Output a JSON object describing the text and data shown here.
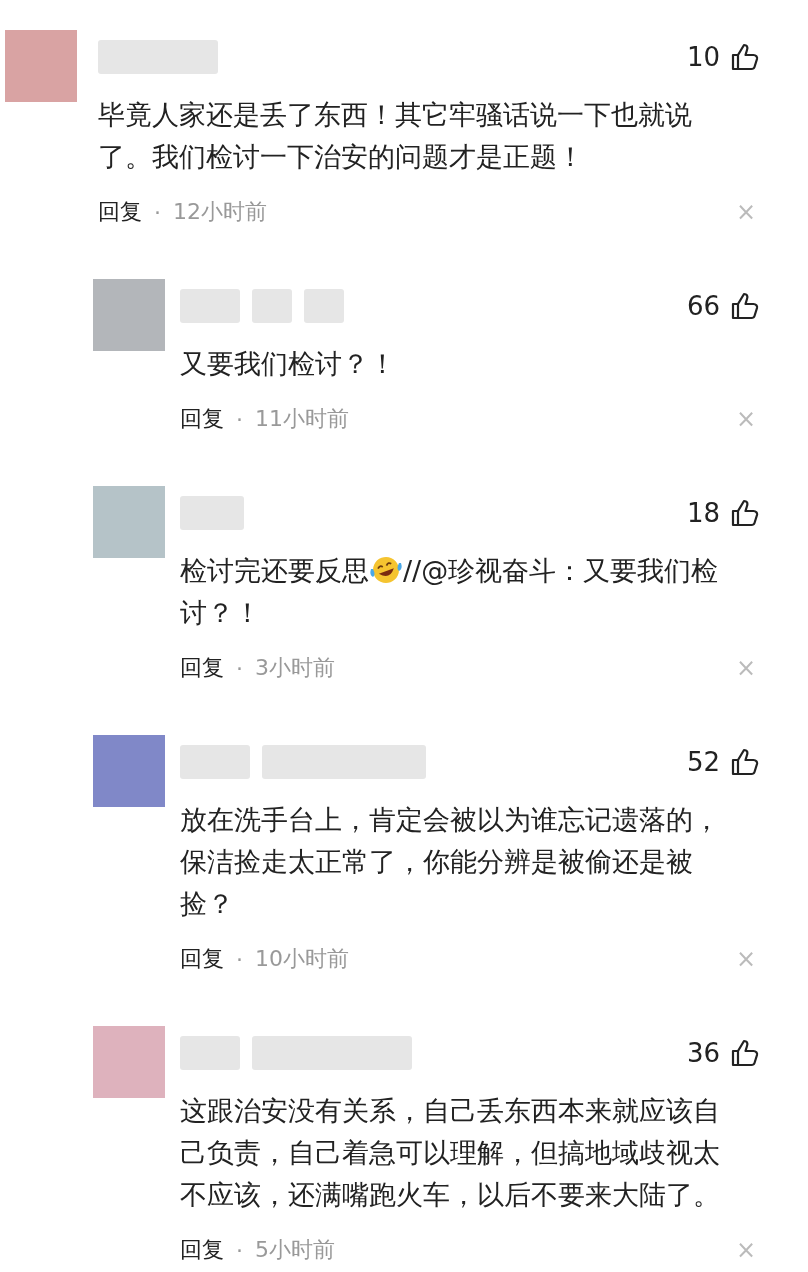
{
  "comment": {
    "color": "#d9a3a3",
    "likes": "10",
    "parts": [
      {
        "kind": "text",
        "text": "毕竟人家还是丢了东西！其它牢骚话说一下也就说了。我们检讨一下治安的问题才是正题！"
      }
    ],
    "reply": "回复",
    "dot": "·",
    "time": "12小时前",
    "close": "×",
    "children": [
      {
        "color": "#b3b6ba",
        "likes": "66",
        "parts": [
          {
            "kind": "text",
            "text": "又要我们检讨？！"
          }
        ],
        "reply": "回复",
        "dot": "·",
        "time": "11小时前",
        "close": "×"
      },
      {
        "color": "#b5c3c8",
        "likes": "18",
        "parts": [
          {
            "kind": "text",
            "text": "检讨完还要反思"
          },
          {
            "kind": "emoji"
          },
          {
            "kind": "text",
            "text": "//@珍视奋斗：又要我们检讨？！"
          }
        ],
        "reply": "回复",
        "dot": "·",
        "time": "3小时前",
        "close": "×"
      },
      {
        "color": "#8088c8",
        "likes": "52",
        "parts": [
          {
            "kind": "text",
            "text": "放在洗手台上，肯定会被以为谁忘记遗落的，保洁捡走太正常了，你能分辨是被偷还是被捡？"
          }
        ],
        "reply": "回复",
        "dot": "·",
        "time": "10小时前",
        "close": "×"
      },
      {
        "color": "#deb2bd",
        "likes": "36",
        "parts": [
          {
            "kind": "text",
            "text": "这跟治安没有关系，自己丢东西本来就应该自己负责，自己着急可以理解，但搞地域歧视太不应该，还满嘴跑火车，以后不要来大陆了。"
          }
        ],
        "reply": "回复",
        "dot": "·",
        "time": "5小时前",
        "close": "×"
      }
    ]
  }
}
